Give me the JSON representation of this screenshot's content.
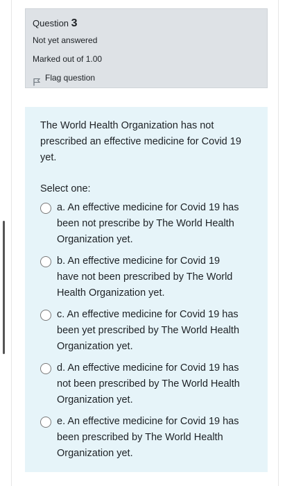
{
  "question": {
    "label": "Question",
    "number": "3",
    "status": "Not yet answered",
    "marks": "Marked out of 1.00",
    "flag_label": "Flag question"
  },
  "content": {
    "question_text": "The World Health Organization has not prescribed an effective medicine for Covid 19 yet.",
    "prompt": "Select one:",
    "answers": [
      {
        "text": "a. An effective medicine for Covid 19 has been not prescribe by The World Health Organization yet."
      },
      {
        "text": "b. An effective medicine for Covid 19 have not been prescribed by The World Health Organization yet."
      },
      {
        "text": "c. An effective medicine for Covid 19 has been yet prescribed by The World Health Organization yet."
      },
      {
        "text": "d. An effective medicine for Covid 19 has not been prescribed by The World Health Organization yet."
      },
      {
        "text": "e. An effective medicine for Covid 19 has been prescribed by The World Health Organization yet."
      }
    ]
  }
}
